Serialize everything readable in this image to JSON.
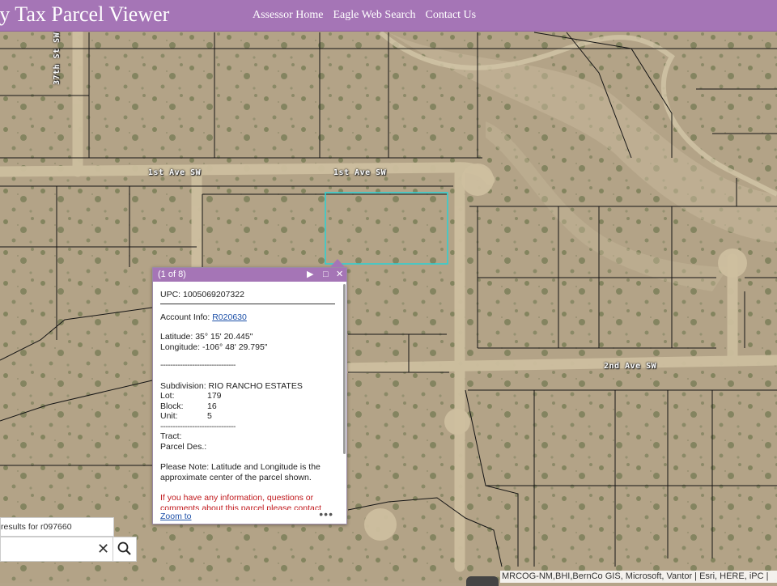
{
  "header": {
    "title": "ty Tax Parcel Viewer",
    "nav": [
      "Assessor Home",
      "Eagle Web Search",
      "Contact Us"
    ]
  },
  "map": {
    "roads": {
      "first_ave_west": "1st Ave SW",
      "first_ave_east": "1st Ave SW",
      "second_ave": "2nd Ave SW",
      "thirty_seventh": "37th St SW"
    },
    "selected_parcel_color": "#2ad1d5"
  },
  "popup": {
    "count": "(1 of 8)",
    "upc": "UPC: 1005069207322",
    "account_label": "Account Info: ",
    "account_link": "R020630",
    "latitude": "Latitude: 35° 15' 20.445\"",
    "longitude": "Longitude: -106° 48' 29.795\"",
    "dashes": "-------------------------------",
    "subdivision": "Subdivision: RIO RANCHO ESTATES",
    "lot_label": "Lot:",
    "lot_value": "179",
    "block_label": "Block:",
    "block_value": "16",
    "unit_label": "Unit:",
    "unit_value": "5",
    "tract": "Tract:",
    "parcel_des": "Parcel Des.:",
    "note": "Please Note: Latitude and Longitude is the approximate center of the parcel shown.",
    "red_note": "If you have any information, questions or comments about this parcel please contact",
    "zoom_to": "Zoom to",
    "more": "•••"
  },
  "search": {
    "results_text": "results for r097660"
  },
  "attribution": "MRCOG-NM,BHI,BernCo GIS, Microsoft, Vantor | Esri, HERE, iPC |"
}
